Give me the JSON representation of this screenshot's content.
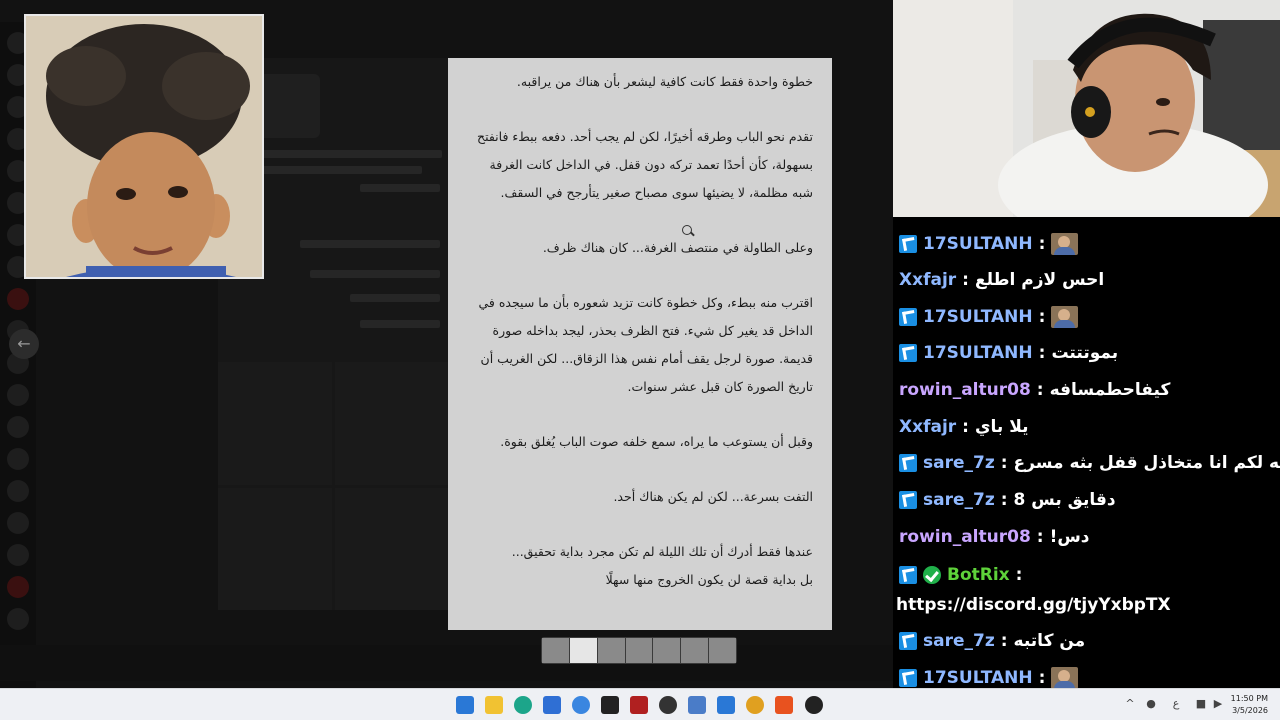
{
  "story": {
    "paragraphs": [
      "خطوة واحدة فقط كانت كافية ليشعر بأن هناك من يراقبه.",
      "تقدم نحو الباب وطرقه أخيرًا، لكن لم يجب أحد. دفعه ببطء فانفتح بسهولة، كأن أحدًا تعمد تركه دون قفل. في الداخل كانت الغرفة شبه مظلمة، لا يضيئها سوى مصباح صغير يتأرجح في السقف.",
      "وعلى الطاولة في منتصف الغرفة... كان هناك ظرف.",
      "اقترب منه ببطء، وكل خطوة كانت تزيد شعوره بأن ما سيجده في الداخل قد يغير كل شيء. فتح الظرف بحذر، ليجد بداخله صورة قديمة. صورة لرجل يقف أمام نفس هذا الزقاق... لكن الغريب أن تاريخ الصورة كان قبل عشر سنوات.",
      "وقبل أن يستوعب ما يراه، سمع خلفه صوت الباب يُغلق بقوة.",
      "التفت بسرعة... لكن لم يكن هناك أحد.",
      "عندها فقط أدرك أن تلك الليلة لم تكن مجرد بداية تحقيق...",
      "بل بداية قصة لن يكون الخروج منها سهلًا"
    ]
  },
  "chat": {
    "messages": [
      {
        "user": "17SULTANH",
        "text": "",
        "badge": "sub",
        "emote": true,
        "color": "blue"
      },
      {
        "user": "Xxfajr",
        "text": "احس لازم اطلع",
        "badge": "",
        "emote": false,
        "color": "blue"
      },
      {
        "user": "17SULTANH",
        "text": "",
        "badge": "sub",
        "emote": true,
        "color": "blue"
      },
      {
        "user": "17SULTANH",
        "text": "بموتتتت",
        "badge": "sub",
        "emote": false,
        "color": "blue"
      },
      {
        "user": "rowin_altur08",
        "text": "كيفاحطمسافه",
        "badge": "",
        "emote": false,
        "color": "purple"
      },
      {
        "user": "Xxfajr",
        "text": "يلا باي",
        "badge": "",
        "emote": false,
        "color": "blue"
      },
      {
        "user": "sare_7z",
        "text": "قايله لكم انا متخاذل قفل بثه مسرع",
        "badge": "sub",
        "emote": false,
        "color": "blue"
      },
      {
        "user": "sare_7z",
        "text": "دقايق بس 8",
        "badge": "sub",
        "emote": false,
        "color": "blue"
      },
      {
        "user": "rowin_altur08",
        "text": "دس!",
        "badge": "",
        "emote": false,
        "color": "purple"
      },
      {
        "user": "BotRix",
        "text": "",
        "badge": "sub+verified",
        "emote": false,
        "color": "green"
      },
      {
        "user": "sare_7z",
        "text": "من كاتبه",
        "badge": "sub",
        "emote": false,
        "color": "blue"
      },
      {
        "user": "17SULTANH",
        "text": "",
        "badge": "sub",
        "emote": true,
        "color": "blue"
      }
    ],
    "botrix_link": "https://discord.gg/tjyYxbpTX",
    "separator": ":"
  },
  "viewer": {
    "thumb_count": 7,
    "active_thumb": 1,
    "prev_icon": "arrow-left-icon",
    "next_icon": "arrow-right-icon"
  },
  "taskbar": {
    "time": "11:50 PM",
    "date": "3/5/2026",
    "icons": [
      "windows-start-icon",
      "file-explorer-icon",
      "edge-icon",
      "store-icon",
      "mail-icon",
      "terminal-icon",
      "recorder-icon",
      "obs-icon",
      "paint-icon",
      "discord-icon",
      "brave-icon",
      "app-icon"
    ]
  },
  "colors": {
    "sub_badge": "#1a8fe3",
    "verified": "#20b04a",
    "username_blue": "#8fb8ff",
    "username_purple": "#c9a6ff",
    "username_green": "#5ed23a",
    "document_bg": "#d2d2d2"
  }
}
